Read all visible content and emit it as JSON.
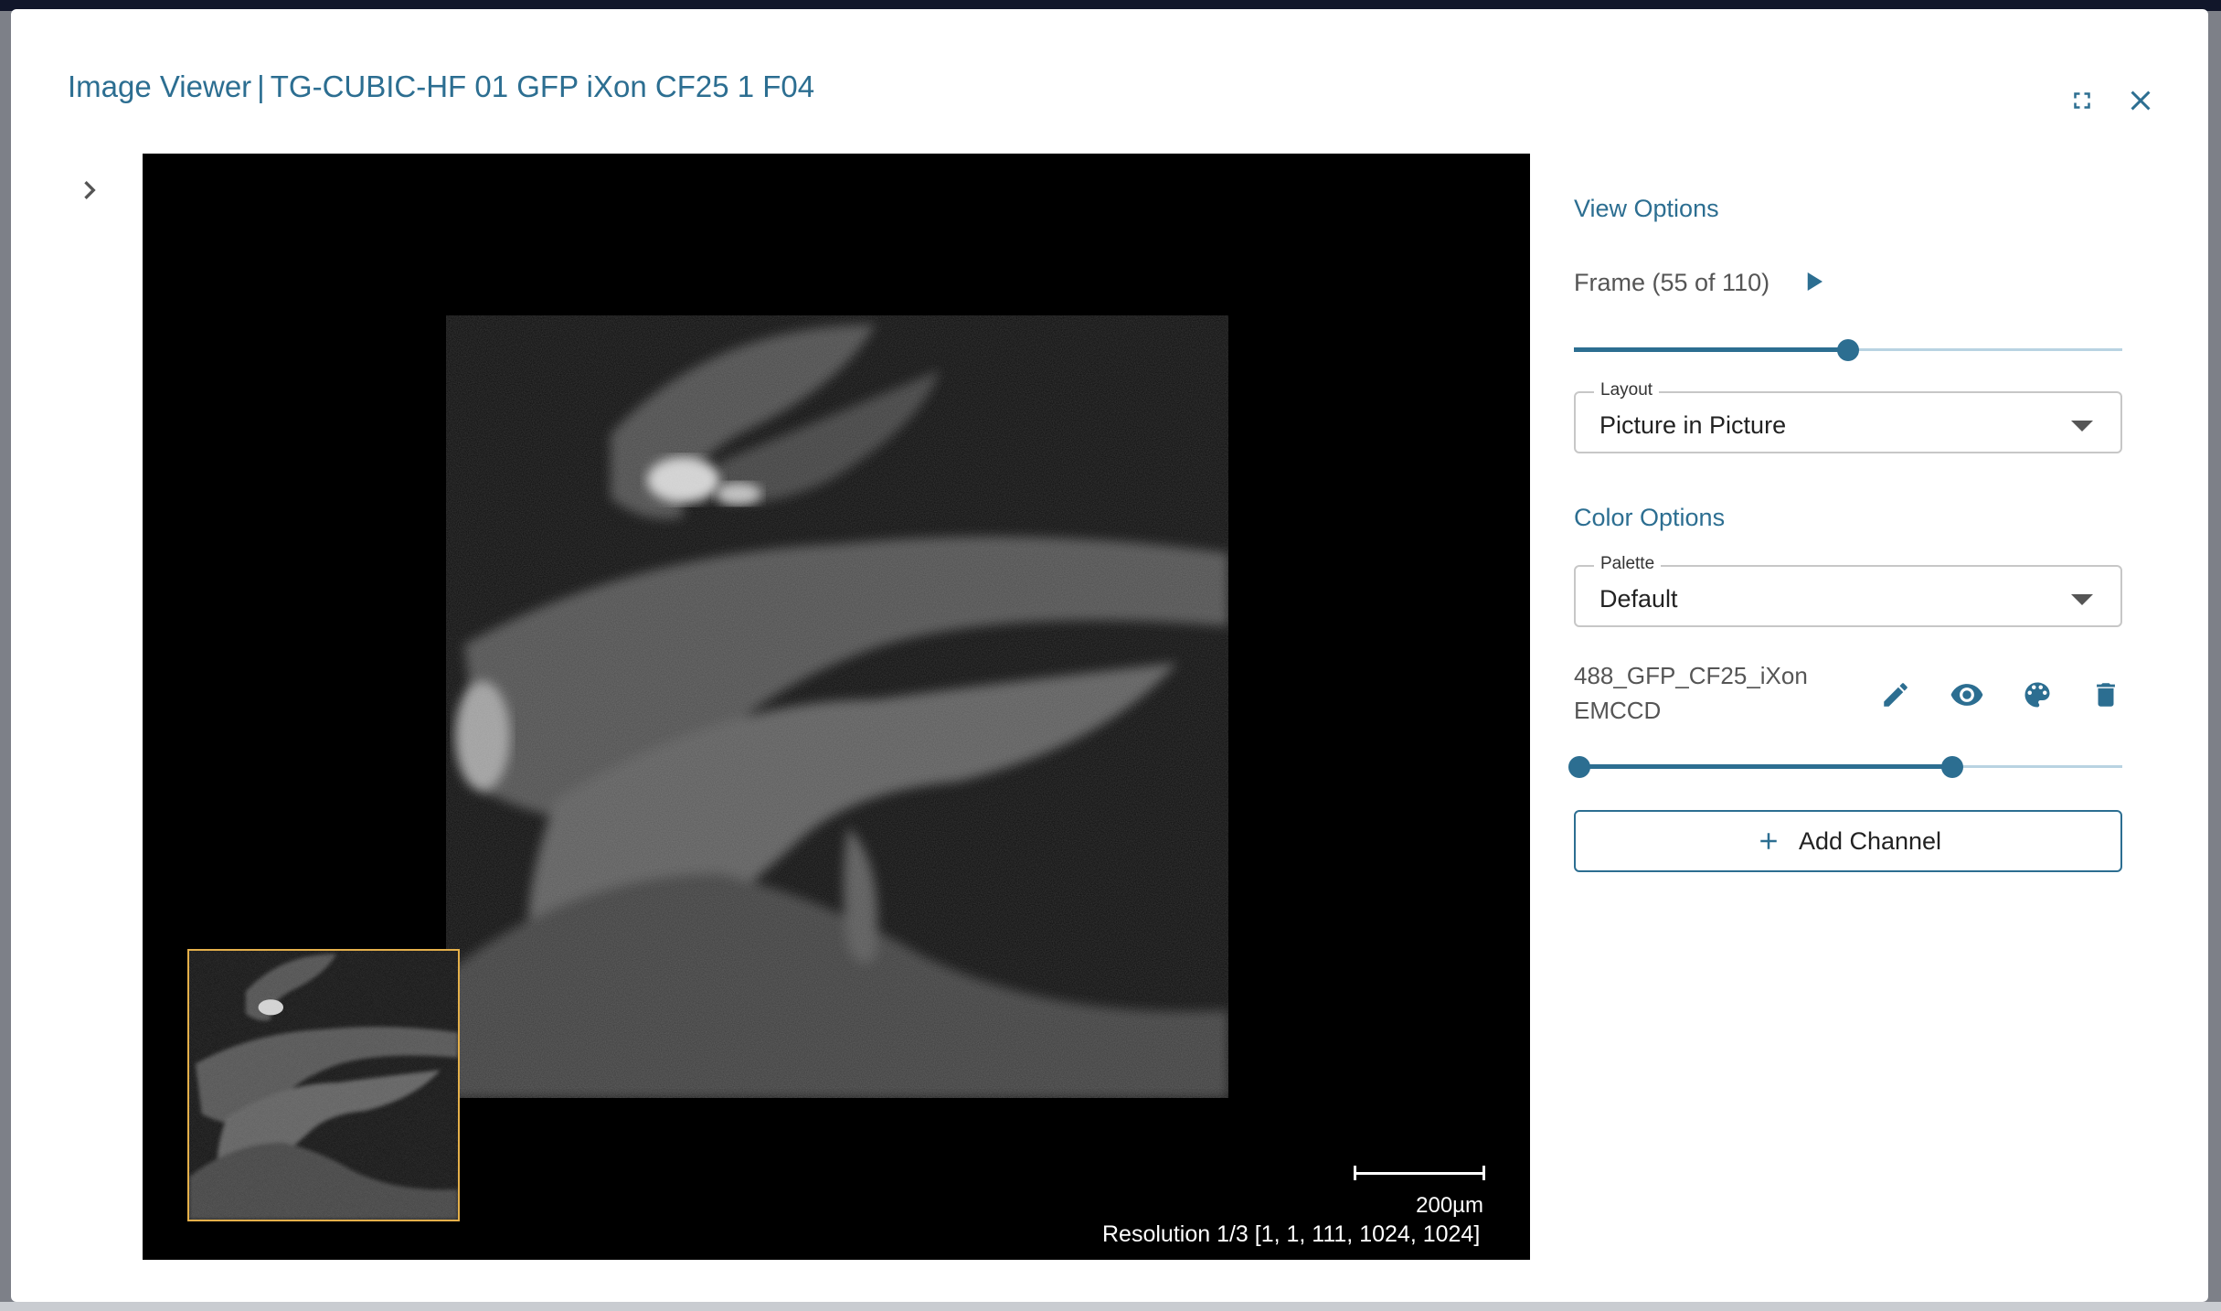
{
  "window": {
    "title_app": "Image Viewer",
    "title_separator": "|",
    "title_file": "TG-CUBIC-HF 01 GFP iXon CF25 1 F04"
  },
  "icons": {
    "fullscreen": "fullscreen-icon",
    "close": "close-icon",
    "expand": "chevron-right-icon",
    "play": "play-icon",
    "edit": "pencil-icon",
    "visibility": "eye-icon",
    "palette": "palette-icon",
    "delete": "trash-icon",
    "add": "plus-icon"
  },
  "colors": {
    "accent": "#2c6e91",
    "overview_border": "#e5b04a"
  },
  "viewer": {
    "scale_label": "200µm",
    "resolution_label": "Resolution 1/3 [1, 1, 111, 1024, 1024]"
  },
  "view_options": {
    "title": "View Options",
    "frame_label": "Frame (55 of 110)",
    "frame_current": 55,
    "frame_total": 110,
    "layout_legend": "Layout",
    "layout_value": "Picture in Picture"
  },
  "color_options": {
    "title": "Color Options",
    "palette_legend": "Palette",
    "palette_value": "Default",
    "channel_name_line1": "488_GFP_CF25_iXon",
    "channel_name_line2": "EMCCD",
    "channel_range": [
      0.01,
      0.69
    ],
    "add_channel_label": "Add Channel"
  }
}
